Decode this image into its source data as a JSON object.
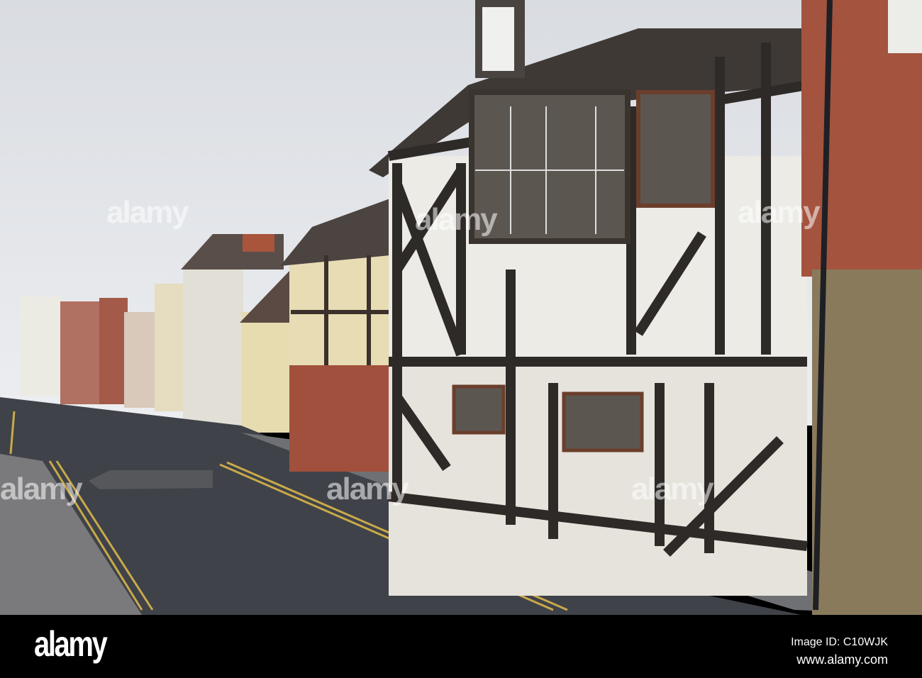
{
  "photo": {
    "subject": "street-with-timber-framed-houses"
  },
  "watermark": {
    "text": "alamy"
  },
  "footer": {
    "logo": "alamy",
    "image_id": "Image ID: C10WJK",
    "url": "www.alamy.com"
  },
  "colors": {
    "sky": "#dfe2e7",
    "road": "#3f4248",
    "timber": "#2e2a27",
    "plaster": "#ecebe6",
    "brick": "#a4533e",
    "stone": "#8a7a5c"
  }
}
